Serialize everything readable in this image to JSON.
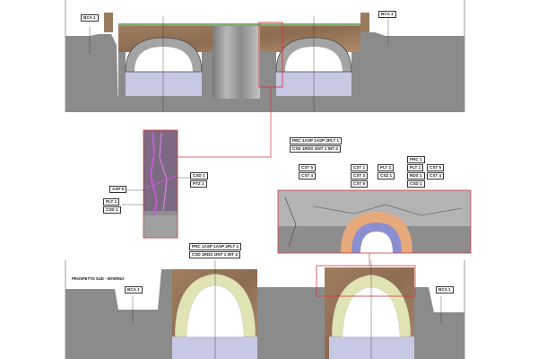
{
  "labels": {
    "bca_top_left": "BCA 1",
    "bca_top_right": "BCA 1",
    "bca_bottom_left": "BCA 1",
    "bca_bottom_right": "BCA 1",
    "csd_1": "CSD 1",
    "ptz_1": "PTZ 1",
    "asp_5": "ASP 5",
    "plt_1_left": "PLT 1",
    "csd_1_left": "CSD 1",
    "top_row1": "PRC 1ASP 1ASP 2PLT 1",
    "top_row2": "CSD 1RDS 1INT 1 INT 4",
    "bot_row1": "PRC 1ASP 1ASP 2PLT 1",
    "bot_row2": "CSD 1RDS 1INT 1 INT 4",
    "cst5_a": "CST 5",
    "cst4_a": "CST 4",
    "cst1_b": "CST 1",
    "cst3_b": "CST 3",
    "cst5_b": "CST 5",
    "plt1_c": "PLT 1",
    "csz1_c": "CSZ 1",
    "prc1_d": "PRC 1",
    "plt1_d": "PLT 1",
    "rds1_d": "RDS 1",
    "csd1_d": "CSD 1",
    "cst5_e": "CST 5",
    "cst4_e": "CST 4",
    "prospetto": "PROSPETTO SUD - INTERNO"
  },
  "colors": {
    "ground": "#8b8b8b",
    "water": "#c7c8e4",
    "masonry": "#9c7a5c",
    "arch_ring": "#e1e3b2",
    "highlight": "#d13a3a"
  }
}
